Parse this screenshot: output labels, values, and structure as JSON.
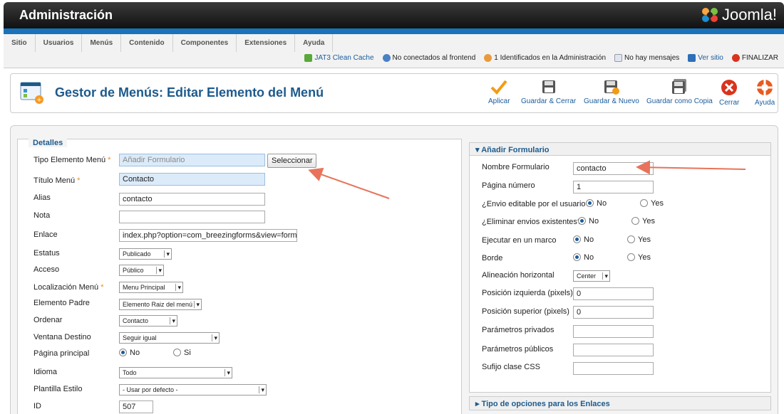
{
  "header": {
    "title": "Administración",
    "logo_text": "Joomla!"
  },
  "menu": [
    "Sitio",
    "Usuarios",
    "Menús",
    "Contenido",
    "Componentes",
    "Extensiones",
    "Ayuda"
  ],
  "status": {
    "cache": "JAT3 Clean Cache",
    "frontend": "No conectados al frontend",
    "admin": "1 Identificados en la Administración",
    "messages": "No hay mensajes",
    "view_site": "Ver sitio",
    "logout": "FINALIZAR"
  },
  "toolbar": {
    "title": "Gestor de Menús: Editar Elemento del Menú",
    "apply": "Aplicar",
    "save_close": "Guardar & Cerrar",
    "save_new": "Guardar & Nuevo",
    "save_copy": "Guardar como Copia",
    "close": "Cerrar",
    "help": "Ayuda"
  },
  "details": {
    "legend": "Detalles",
    "type_label": "Tipo Elemento Menú",
    "type_value": "Añadir Formulario",
    "select_btn": "Seleccionar",
    "title_label": "Título Menú",
    "title_value": "Contacto",
    "alias_label": "Alias",
    "alias_value": "contacto",
    "note_label": "Nota",
    "note_value": "",
    "link_label": "Enlace",
    "link_value": "index.php?option=com_breezingforms&view=form",
    "status_label": "Estatus",
    "status_value": "Publicado",
    "access_label": "Acceso",
    "access_value": "Público",
    "location_label": "Localización Menú",
    "location_value": "Menu Principal",
    "parent_label": "Elemento Padre",
    "parent_value": "Elemento Raiz del menú",
    "order_label": "Ordenar",
    "order_value": "Contacto",
    "target_label": "Ventana Destino",
    "target_value": "Seguir igual",
    "home_label": "Página principal",
    "home_no": "No",
    "home_yes": "Si",
    "lang_label": "Idioma",
    "lang_value": "Todo",
    "style_label": "Plantilla Estilo",
    "style_value": "- Usar por defecto -",
    "id_label": "ID",
    "id_value": "507"
  },
  "form_panel": {
    "heading": "Añadir Formulario",
    "name_label": "Nombre Formulario",
    "name_value": "contacto",
    "page_label": "Página número",
    "page_value": "1",
    "editable_label": "¿Envio editable por el usuario?",
    "delete_label": "¿Eliminar envios existentes?",
    "frame_label": "Ejecutar en un marco",
    "border_label": "Borde",
    "no": "No",
    "yes": "Yes",
    "align_label": "Alineación horizontal",
    "align_value": "Center",
    "left_label": "Posición izquierda (pixels)",
    "left_value": "0",
    "top_label": "Posición superior (pixels)",
    "top_value": "0",
    "private_label": "Parámetros privados",
    "public_label": "Parámetros públicos",
    "css_label": "Sufijo clase CSS",
    "links_heading": "Tipo de opciones para los Enlaces"
  },
  "colors": {
    "accent": "#1d5a8c",
    "header_bar": "#1a73ba",
    "arrow": "#e8735a"
  }
}
